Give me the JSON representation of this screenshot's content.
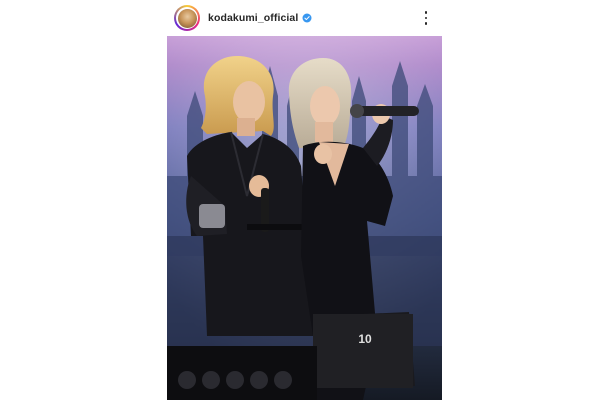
{
  "post": {
    "username": "kodakumi_official",
    "verified": true,
    "avatar_icon": "profile-avatar",
    "more_icon": "more-options-vertical-icon",
    "photo_description_colors": {
      "sky_top": "#b48bc9",
      "sky_mid": "#6f78b8",
      "stage_dark": "#1c2230",
      "outfit": "#15151a"
    },
    "monitor_text": "10"
  },
  "colors": {
    "verified_blue": "#3897f0",
    "text_primary": "#262626"
  }
}
